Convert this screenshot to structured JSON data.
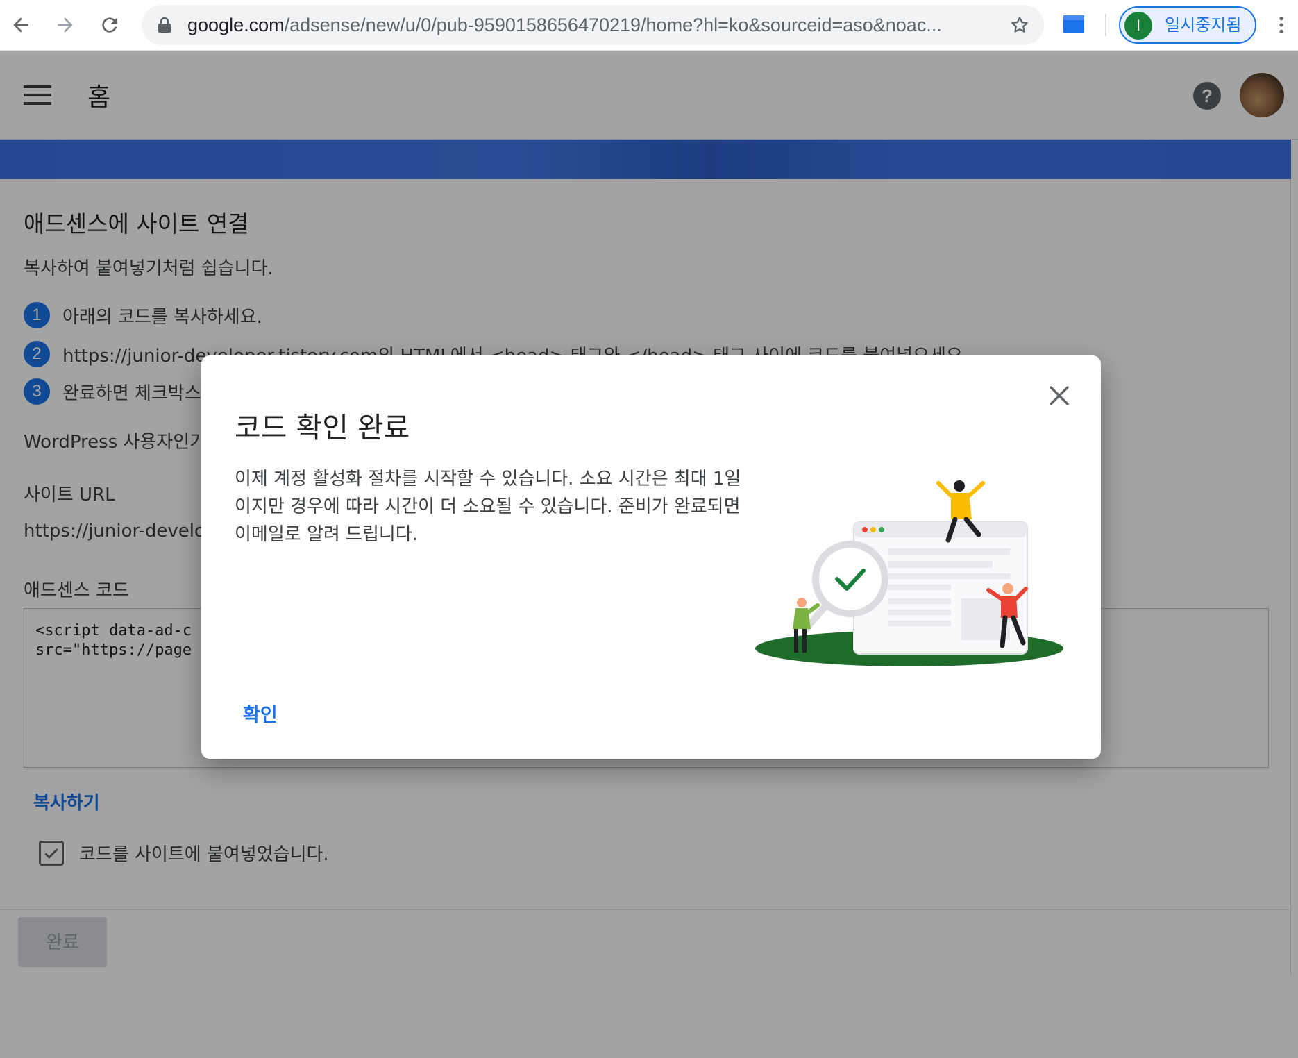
{
  "browser": {
    "url_host": "google.com",
    "url_rest": "/adsense/new/u/0/pub-9590158656470219/home?hl=ko&sourceid=aso&noac...",
    "profile_initial": "I",
    "profile_label": "일시중지됨"
  },
  "header": {
    "title": "홈"
  },
  "page": {
    "section_title": "애드센스에 사이트 연결",
    "section_subtitle": "복사하여 붙여넣기처럼 쉽습니다.",
    "steps": [
      {
        "num": "1",
        "text": "아래의 코드를 복사하세요."
      },
      {
        "num": "2",
        "text": "https://junior-developer.tistory.com의 HTML에서 <head> 태그와 </head> 태그 사이에 코드를 붙여넣으세요."
      },
      {
        "num": "3",
        "text": "완료하면 체크박스"
      }
    ],
    "wordpress_text": "WordPress 사용자인가",
    "site_url_label": "사이트 URL",
    "site_url_value": "https://junior-develo",
    "code_label": "애드센스 코드",
    "code_text": "<script data-ad-c\nsrc=\"https://page",
    "copy_label": "복사하기",
    "checkbox_label": "코드를 사이트에 붙여넣었습니다.",
    "done_label": "완료"
  },
  "dialog": {
    "title": "코드 확인 완료",
    "body": "이제 계정 활성화 절차를 시작할 수 있습니다. 소요 시간은 최대 1일이지만 경우에 따라 시간이 더 소요될 수 있습니다. 준비가 완료되면 이메일로 알려 드립니다.",
    "ok_label": "확인"
  },
  "colors": {
    "accent": "#1a73e8",
    "banner": "#3c6ee0",
    "ground": "#1e6b2a",
    "check": "#188038"
  }
}
